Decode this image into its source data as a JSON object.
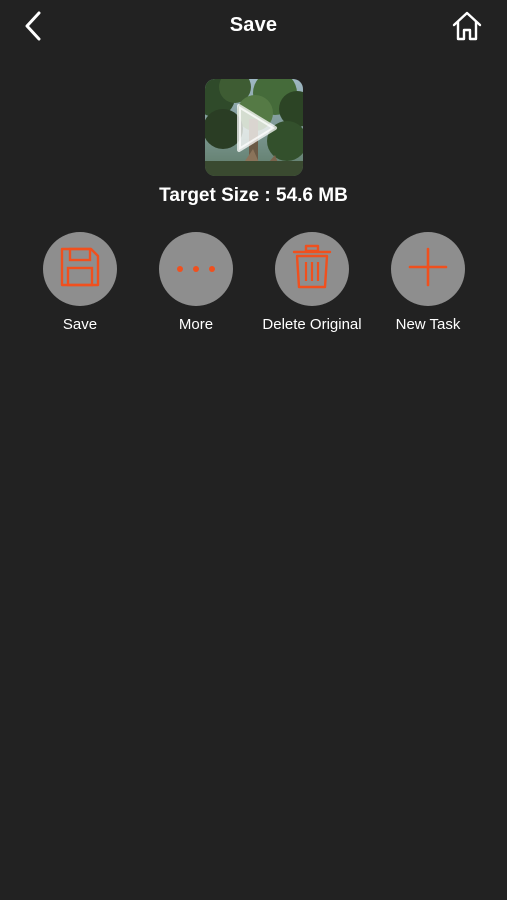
{
  "colors": {
    "background": "#222222",
    "accent": "#f0501e",
    "button_circle": "#8e8e8e",
    "text": "#ffffff"
  },
  "nav": {
    "title": "Save",
    "back_icon": "chevron-left-icon",
    "home_icon": "home-icon"
  },
  "video": {
    "thumbnail": "video-thumbnail",
    "play_icon": "play-icon"
  },
  "target_size": "Target Size : 54.6 MB",
  "actions": [
    {
      "label": "Save",
      "icon": "floppy-disk-icon"
    },
    {
      "label": "More",
      "icon": "more-dots-icon"
    },
    {
      "label": "Delete Original",
      "icon": "trash-icon"
    },
    {
      "label": "New Task",
      "icon": "plus-icon"
    }
  ]
}
